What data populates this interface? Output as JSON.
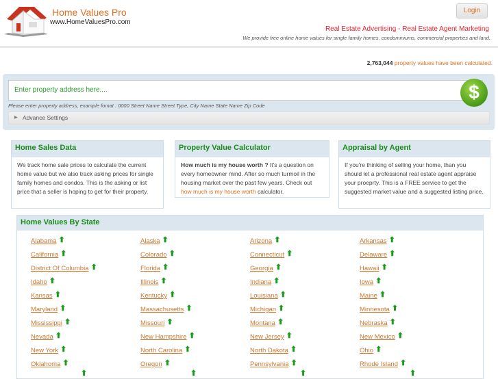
{
  "header": {
    "brand": "Home Values Pro",
    "url": "www.HomeValuesPro.com",
    "login": "Login",
    "link1": "Real Estate Advertising",
    "sep": "-",
    "link2": "Real Estate Agent Marketing",
    "tagline": "We provide free online home values for single family homes, condominiums, commercial properties and land."
  },
  "counter": {
    "count": "2,763,044",
    "text": "property values have been calculated."
  },
  "search": {
    "placeholder": "Enter property address here....",
    "hint": "Please enter property address, example fomat : 0000 Street Name Street Type, City Name State Name Zip Code",
    "advanced": "Advance Settings",
    "button_icon": "dollar-icon",
    "button_glyph": "$"
  },
  "boxes": [
    {
      "title": "Home Sales Data",
      "text": "We track home sale prices to calculate the current home value but we also track asking prices for single family homes and condos. This is the asking or list price that a seller is hoping to get for their property."
    },
    {
      "title": "Property Value Calculator",
      "bold": "How much is my house worth ?",
      "text": " It's a question on every homeowner mind. After so much turmoil in the housing market over the past few years. Check out ",
      "link": "how much is my house worth",
      "tail": " calculator."
    },
    {
      "title": "Appraisal by Agent",
      "text": "If you're thinking of selling your home, than you should let a professional real estate agent appraise your proeprty. This is a FREE service to get the suggested market value and a suggested listing price."
    }
  ],
  "states": {
    "title": "Home Values By State",
    "trend_icon": "arrow-up-icon",
    "trend_color": "#1a9a1a",
    "items": [
      "Alabama",
      "Alaska",
      "Arizona",
      "Arkansas",
      "California",
      "Colorado",
      "Connecticut",
      "Delaware",
      "District Of Columbia",
      "Florida",
      "Georgia",
      "Hawaii",
      "Idaho",
      "Illinois",
      "Indiana",
      "Iowa",
      "Kansas",
      "Kentucky",
      "Louisiana",
      "Maine",
      "Maryland",
      "Massachusetts",
      "Michigan",
      "Minnesota",
      "Mississippi",
      "Missouri",
      "Montana",
      "Nebraska",
      "Nevada",
      "New Hampshire",
      "New Jersey",
      "New Mexico",
      "New York",
      "North Carolina",
      "North Dakota",
      "Ohio",
      "Oklahoma",
      "Oregon",
      "Pennsylvania",
      "Rhode Island"
    ]
  }
}
